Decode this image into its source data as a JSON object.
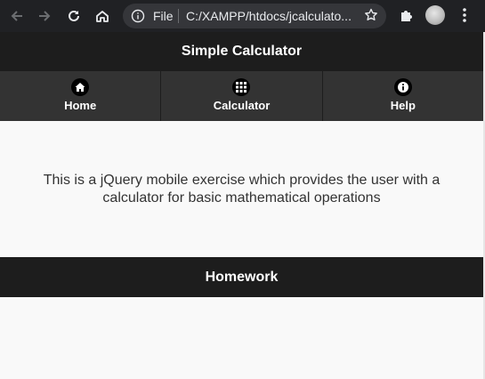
{
  "browser": {
    "back_icon": "arrow-left-icon",
    "forward_icon": "arrow-right-icon",
    "reload_icon": "reload-icon",
    "home_icon": "home-icon",
    "site_info_icon": "info-icon",
    "file_label": "File",
    "url": "C:/XAMPP/htdocs/jcalculato...",
    "bookmark_icon": "star-icon",
    "extensions_icon": "puzzle-icon",
    "menu_icon": "kebab-menu-icon",
    "chrome_color": "#202124"
  },
  "header": {
    "title": "Simple Calculator"
  },
  "navbar": {
    "items": [
      {
        "label": "Home",
        "icon": "home-icon"
      },
      {
        "label": "Calculator",
        "icon": "grid-icon"
      },
      {
        "label": "Help",
        "icon": "info-icon"
      }
    ]
  },
  "content": {
    "text": "This is a jQuery mobile exercise which provides the user with a calculator for basic mathematical operations"
  },
  "footer": {
    "title": "Homework"
  },
  "colors": {
    "bar": "#1d1d1d",
    "nav_button": "#333333",
    "page_background": "#f9f9f9",
    "text": "#333333"
  }
}
